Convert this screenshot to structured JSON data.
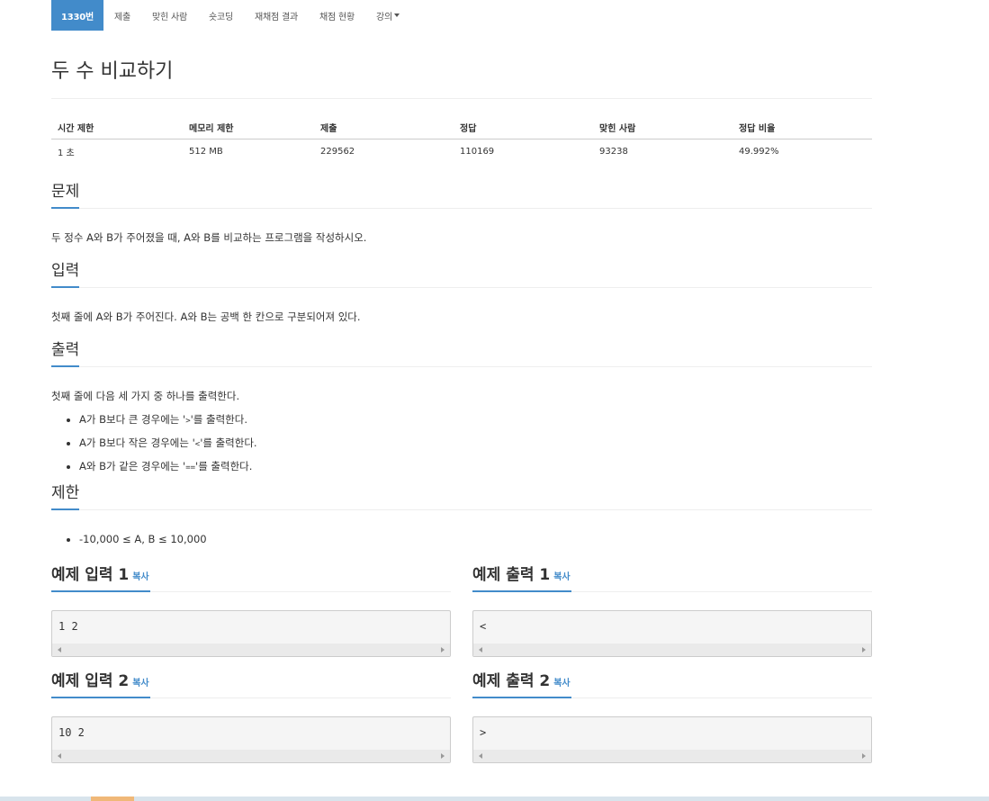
{
  "nav": {
    "items": [
      {
        "label": "1330번",
        "active": true
      },
      {
        "label": "제출"
      },
      {
        "label": "맞힌 사람"
      },
      {
        "label": "숏코딩"
      },
      {
        "label": "재채점 결과"
      },
      {
        "label": "채점 현황"
      },
      {
        "label": "강의"
      }
    ]
  },
  "problem": {
    "title": "두 수 비교하기",
    "info_headers": [
      "시간 제한",
      "메모리 제한",
      "제출",
      "정답",
      "맞힌 사람",
      "정답 비율"
    ],
    "info_values": [
      "1 초",
      "512 MB",
      "229562",
      "110169",
      "93238",
      "49.992%"
    ]
  },
  "sections": {
    "problem_title": "문제",
    "problem_text": "두 정수 A와 B가 주어졌을 때, A와 B를 비교하는 프로그램을 작성하시오.",
    "input_title": "입력",
    "input_text": "첫째 줄에 A와 B가 주어진다. A와 B는 공백 한 칸으로 구분되어져 있다.",
    "output_title": "출력",
    "output_text": "첫째 줄에 다음 세 가지 중 하나를 출력한다.",
    "output_items": [
      {
        "pre": "A가 B보다 큰 경우에는 '",
        "code": ">",
        "post": "'를 출력한다."
      },
      {
        "pre": "A가 B보다 작은 경우에는 '",
        "code": "<",
        "post": "'를 출력한다."
      },
      {
        "pre": "A와 B가 같은 경우에는 '",
        "code": "==",
        "post": "'를 출력한다."
      }
    ],
    "limit_title": "제한",
    "limit_items": [
      "-10,000 ≤ A, B ≤ 10,000"
    ]
  },
  "samples": {
    "copy_label": "복사",
    "input1_title": "예제 입력 1",
    "input1": "1 2",
    "output1_title": "예제 출력 1",
    "output1": "<",
    "input2_title": "예제 입력 2",
    "input2": "10 2",
    "output2_title": "예제 출력 2",
    "output2": ">"
  },
  "colors": {
    "accent": "#428bca",
    "text": "#333333",
    "rule": "#eeeeee",
    "code_bg": "#f5f5f5"
  }
}
